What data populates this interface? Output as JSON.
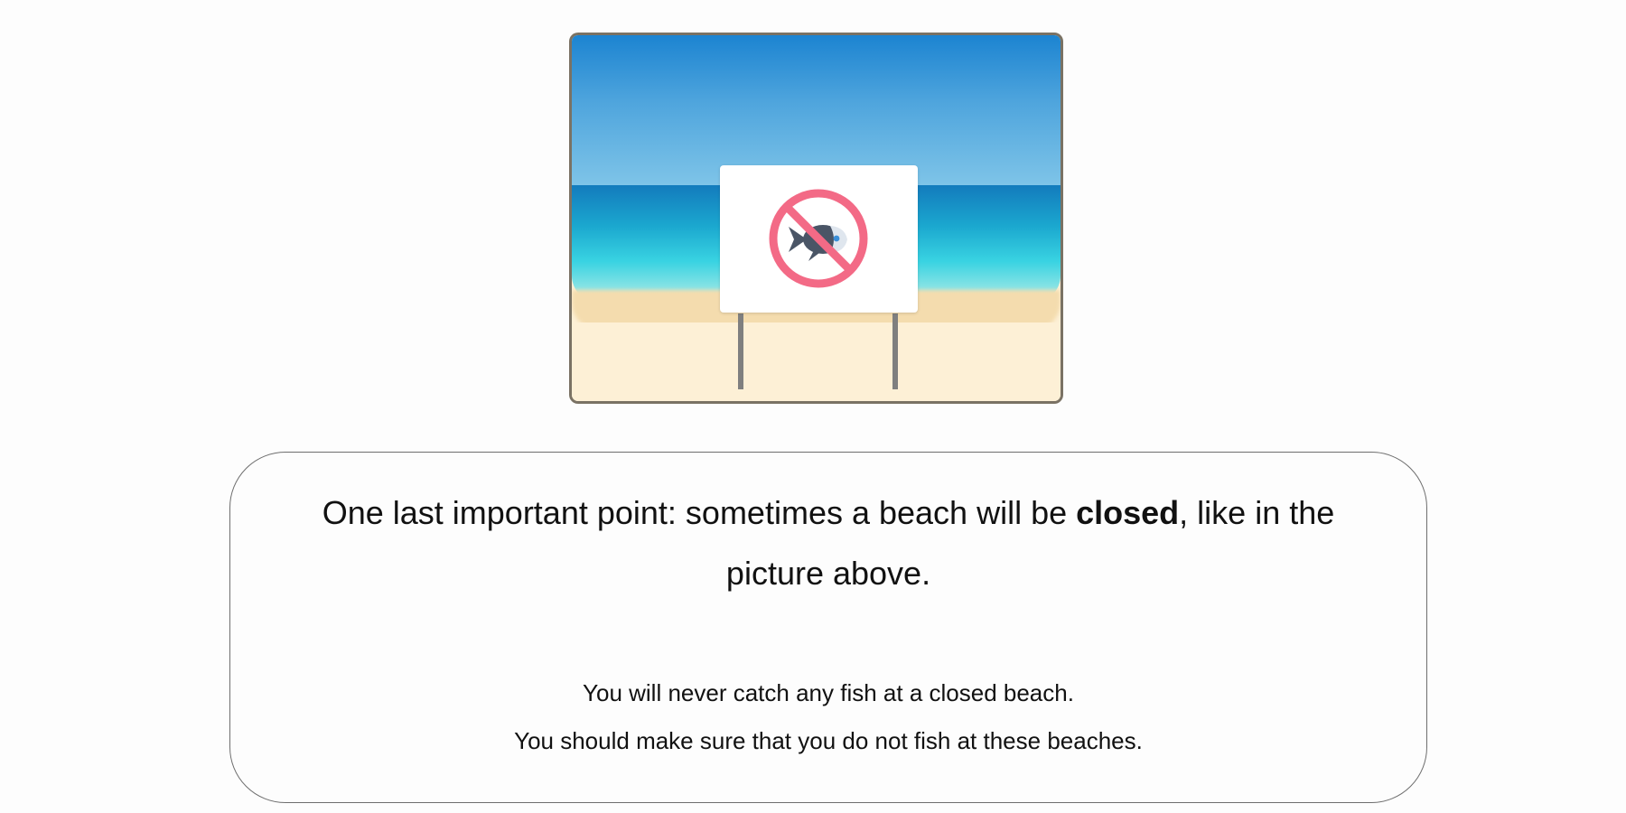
{
  "picture": {
    "icon": "no-fishing-sign",
    "colors": {
      "sky_top": "#1c84d1",
      "sea": "#1ba8cf",
      "sand": "#fdf0d6",
      "prohibition_red": "#f36a86",
      "fish": "#4a5566"
    }
  },
  "card": {
    "main": {
      "before_bold": "One last important point: sometimes a beach will be ",
      "bold": "closed",
      "after_bold": ", like in the picture above."
    },
    "sub_lines": [
      "You will never catch any fish at a closed beach.",
      "You should make sure that you do not fish at these beaches."
    ]
  }
}
